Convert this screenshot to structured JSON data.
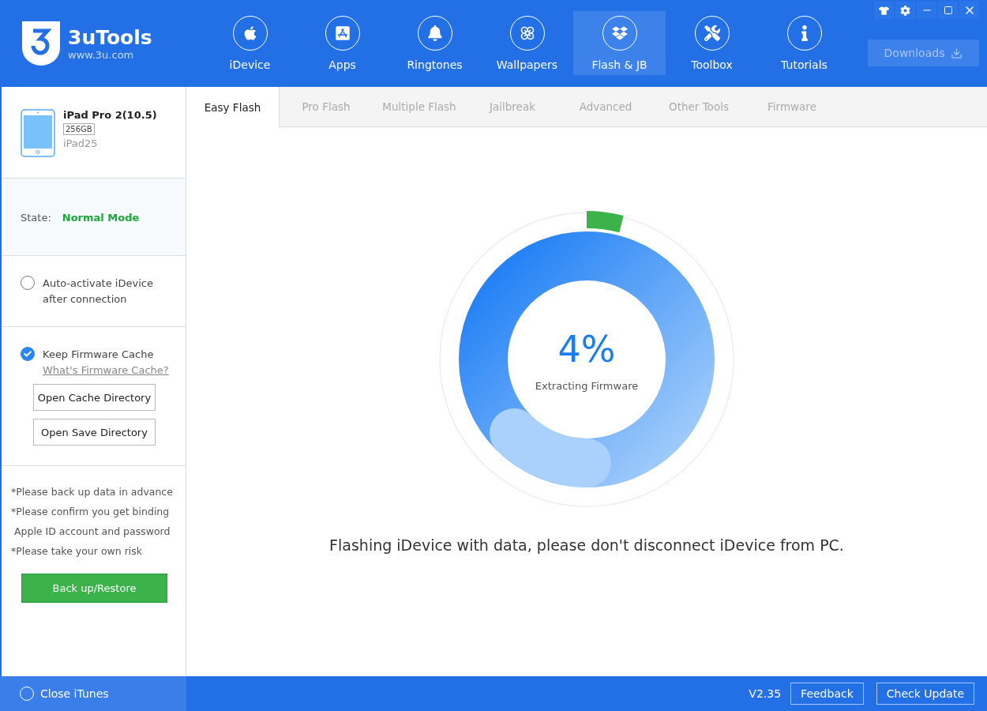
{
  "brand": {
    "name": "3uTools",
    "url": "www.3u.com"
  },
  "nav": [
    {
      "label": "iDevice",
      "kind": "apple",
      "selected": false
    },
    {
      "label": "Apps",
      "kind": "appstore",
      "selected": false
    },
    {
      "label": "Ringtones",
      "kind": "bell",
      "selected": false
    },
    {
      "label": "Wallpapers",
      "kind": "flower",
      "selected": false
    },
    {
      "label": "Flash & JB",
      "kind": "box",
      "selected": true
    },
    {
      "label": "Toolbox",
      "kind": "tools",
      "selected": false
    },
    {
      "label": "Tutorials",
      "kind": "info",
      "selected": false
    }
  ],
  "downloads": {
    "label": "Downloads"
  },
  "device": {
    "name": "iPad Pro 2(10.5)",
    "storage": "256GB",
    "model": "iPad25"
  },
  "state": {
    "label": "State:",
    "value": "Normal Mode"
  },
  "options": [
    {
      "label": "Auto-activate iDevice after connection",
      "checked": false
    },
    {
      "label": "Keep Firmware Cache",
      "checked": true,
      "link": "What's Firmware Cache?"
    }
  ],
  "directory_buttons": [
    "Open Cache Directory",
    "Open Save Directory"
  ],
  "notes": [
    "*Please back up data in advance",
    "*Please confirm you get binding",
    " Apple ID account and password",
    "*Please take your own risk"
  ],
  "backup_button": "Back up/Restore",
  "tabs": [
    {
      "label": "Easy Flash",
      "selected": true
    },
    {
      "label": "Pro Flash",
      "selected": false
    },
    {
      "label": "Multiple Flash",
      "selected": false
    },
    {
      "label": "Jailbreak",
      "selected": false
    },
    {
      "label": "Advanced",
      "selected": false
    },
    {
      "label": "Other Tools",
      "selected": false
    },
    {
      "label": "Firmware",
      "selected": false
    }
  ],
  "progress": {
    "percent": "4%",
    "level": 0.04,
    "status": "Extracting Firmware"
  },
  "message": "Flashing iDevice with data, please don't disconnect iDevice from PC.",
  "status_bar": {
    "close_itunes": {
      "label": "Close iTunes",
      "checked": false
    },
    "version": "V2.35",
    "buttons": [
      "Feedback",
      "Check Update"
    ]
  }
}
